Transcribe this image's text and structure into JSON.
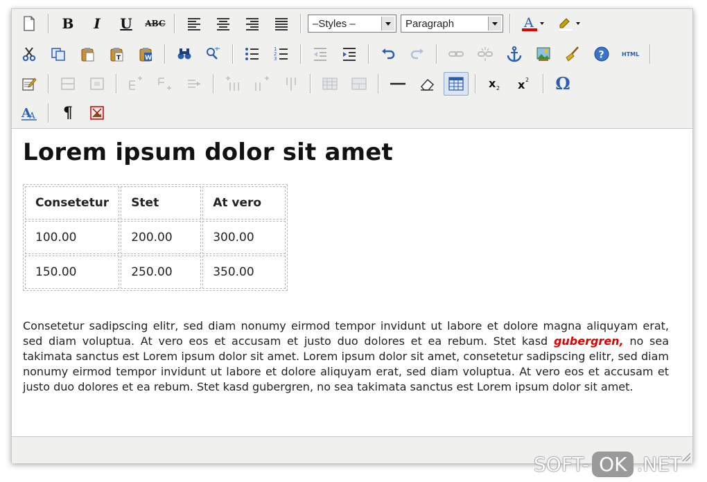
{
  "toolbar": {
    "styles_value": "–Styles –",
    "format_value": "Paragraph",
    "icons": {
      "bold": "B",
      "italic": "I",
      "underline": "U",
      "strike": "ABC",
      "subscript": "x",
      "superscript": "x",
      "omega": "Ω",
      "pilcrow": "¶",
      "html": "HTML",
      "font_color": "A",
      "styles_props": "A"
    },
    "colors": {
      "accent_blue": "#2a5db0",
      "font_color_bar": "#e00000",
      "highlight_bar": "#ffffff"
    }
  },
  "document": {
    "heading": "Lorem ipsum dolor sit amet",
    "table": {
      "headers": [
        "Consetetur",
        "Stet",
        "At vero"
      ],
      "rows": [
        [
          "100.00",
          "200.00",
          "300.00"
        ],
        [
          "150.00",
          "250.00",
          "350.00"
        ]
      ]
    },
    "paragraph_before": "Consetetur sadipscing elitr, sed diam nonumy eirmod tempor invidunt ut labore et dolore magna aliquyam erat, sed diam voluptua. At vero eos et accusam et justo duo dolores et ea rebum. Stet kasd ",
    "paragraph_highlight": "gubergren,",
    "paragraph_after": " no sea takimata sanctus est Lorem ipsum dolor sit amet. Lorem ipsum dolor sit amet, consetetur sadipscing elitr, sed diam nonumy eirmod tempor invidunt ut labore et dolore aliquyam erat, sed diam voluptua. At vero eos et accusam et justo duo dolores et ea rebum. Stet kasd gubergren, no sea takimata sanctus est Lorem ipsum dolor sit amet.",
    "highlight_color": "#e00000"
  },
  "watermark": {
    "left": "SOFT-",
    "middle": "OK",
    "right": ".NET"
  }
}
